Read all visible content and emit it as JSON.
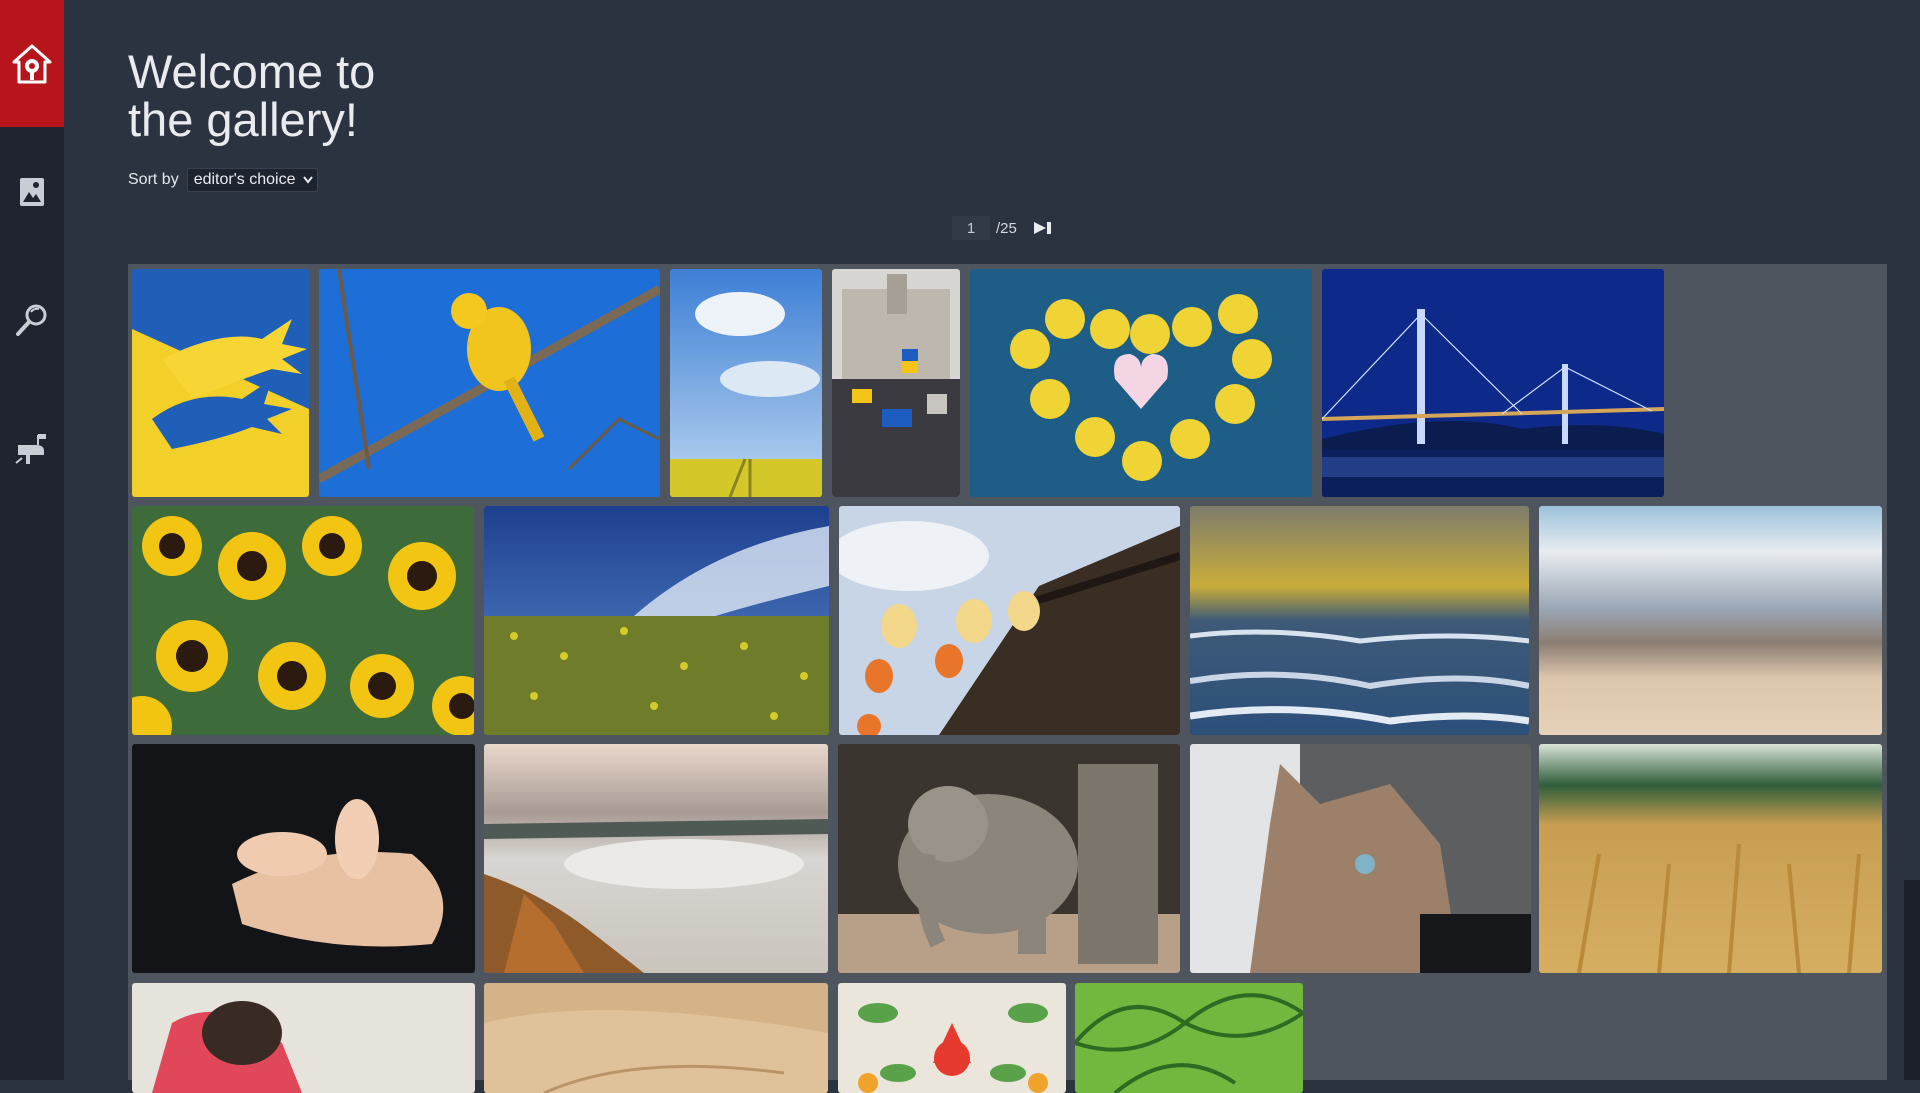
{
  "title": "Welcome to the gallery!",
  "sort": {
    "label": "Sort by",
    "selected": "editor's choice"
  },
  "pager": {
    "current": "1",
    "total": "/25"
  },
  "sidebar": {
    "items": [
      {
        "icon": "home-logo-icon"
      },
      {
        "icon": "gallery-icon"
      },
      {
        "icon": "search-magnifier-icon"
      },
      {
        "icon": "mailbox-icon"
      }
    ]
  },
  "gallery": {
    "images": [
      {
        "subject": "yellow-blue-hands-illustration"
      },
      {
        "subject": "yellow-canary-on-branch"
      },
      {
        "subject": "rapeseed-field-sky"
      },
      {
        "subject": "ukraine-flag-rally"
      },
      {
        "subject": "yellow-flowers-heart"
      },
      {
        "subject": "blue-lit-bridge-night"
      },
      {
        "subject": "sunflowers"
      },
      {
        "subject": "wildflower-field-blue-sky"
      },
      {
        "subject": "lanterns-old-house"
      },
      {
        "subject": "sea-waves-golden-sky"
      },
      {
        "subject": "blurred-beach"
      },
      {
        "subject": "baby-feet-in-hand"
      },
      {
        "subject": "misty-river-valley"
      },
      {
        "subject": "baby-elephant"
      },
      {
        "subject": "cat-looking-up"
      },
      {
        "subject": "wheat-field"
      },
      {
        "subject": "mother-and-baby"
      },
      {
        "subject": "sand-dunes"
      },
      {
        "subject": "folk-flower-pattern"
      },
      {
        "subject": "green-leaves-pattern"
      }
    ]
  }
}
